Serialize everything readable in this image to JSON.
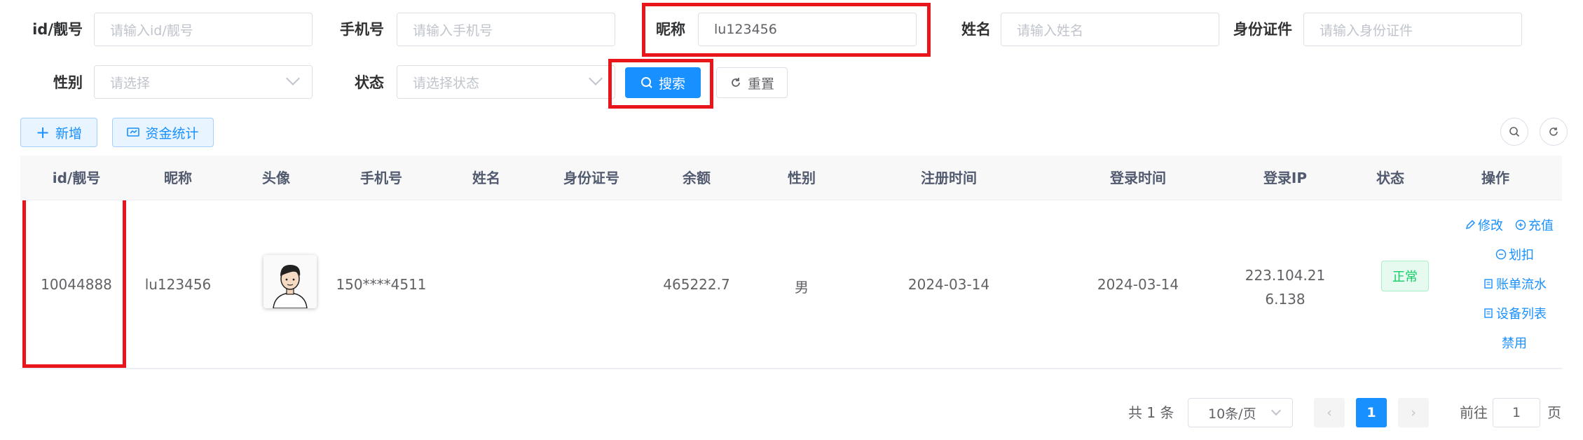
{
  "filters": {
    "id": {
      "label": "id/靓号",
      "placeholder": "请输入id/靓号"
    },
    "phone": {
      "label": "手机号",
      "placeholder": "请输入手机号"
    },
    "nickname": {
      "label": "昵称",
      "value": "lu123456"
    },
    "name": {
      "label": "姓名",
      "placeholder": "请输入姓名"
    },
    "idcard": {
      "label": "身份证件",
      "placeholder": "请输入身份证件"
    },
    "gender": {
      "label": "性别",
      "placeholder": "请选择"
    },
    "status": {
      "label": "状态",
      "placeholder": "请选择状态"
    }
  },
  "actions": {
    "search": "搜索",
    "reset": "重置",
    "add": "新增",
    "funds": "资金统计"
  },
  "table": {
    "headers": [
      "id/靓号",
      "昵称",
      "头像",
      "手机号",
      "姓名",
      "身份证号",
      "余额",
      "性别",
      "注册时间",
      "登录时间",
      "登录IP",
      "状态",
      "操作"
    ],
    "row": {
      "id": "10044888",
      "nickname": "lu123456",
      "phone": "150****4511",
      "name": "",
      "idcard": "",
      "balance": "465222.7",
      "gender": "男",
      "reg_time": "2024-03-14",
      "login_time": "2024-03-14",
      "ip_line1": "223.104.21",
      "ip_line2": "6.138",
      "status": "正常",
      "ops": {
        "edit": "修改",
        "recharge": "充值",
        "deduct": "划扣",
        "ledger": "账单流水",
        "devices": "设备列表",
        "ban": "禁用"
      }
    }
  },
  "pagination": {
    "total": "共 1 条",
    "page_size": "10条/页",
    "current": "1",
    "goto_prefix": "前往",
    "goto_value": "1",
    "goto_suffix": "页"
  },
  "colors": {
    "primary": "#1890ff",
    "highlight": "#e8151b",
    "success": "#13ce66"
  }
}
